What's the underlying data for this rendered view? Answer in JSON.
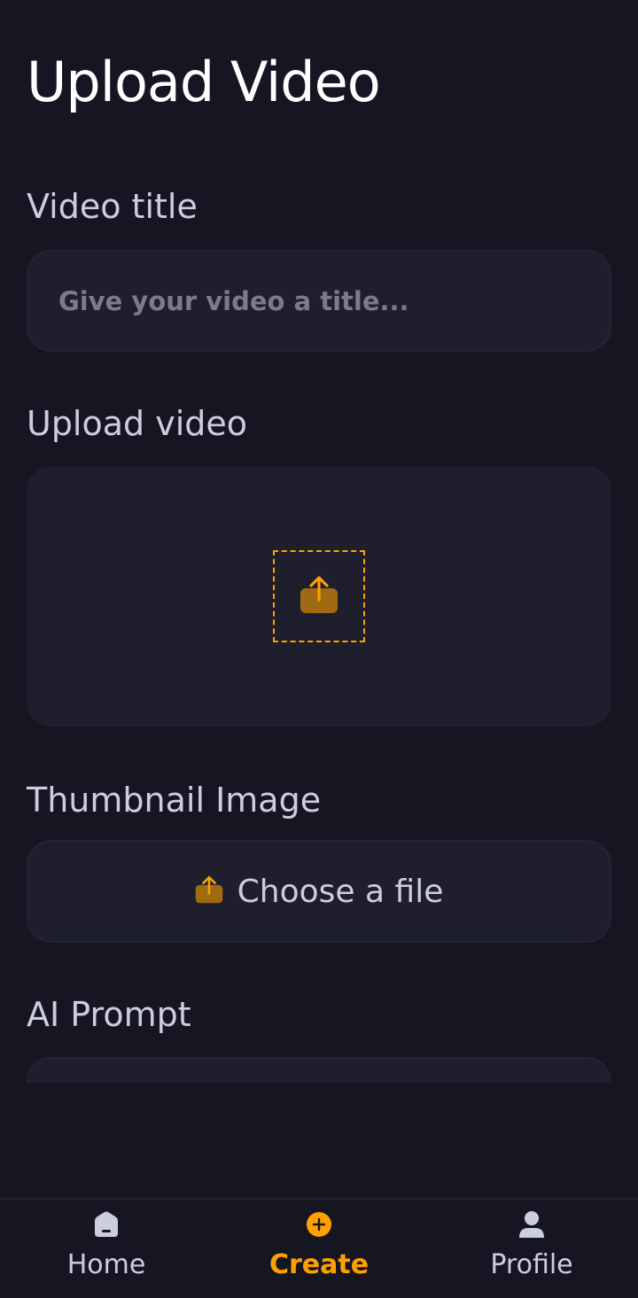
{
  "page": {
    "title": "Upload Video"
  },
  "form": {
    "video_title": {
      "label": "Video title",
      "value": "",
      "placeholder": "Give your video a title..."
    },
    "upload_video": {
      "label": "Upload video",
      "icon": "upload-icon"
    },
    "thumbnail": {
      "label": "Thumbnail Image",
      "button_label": "Choose a file",
      "icon": "upload-icon"
    },
    "ai_prompt": {
      "label": "AI Prompt",
      "value": ""
    }
  },
  "tabbar": {
    "items": [
      {
        "label": "Home",
        "icon": "home-icon",
        "active": false
      },
      {
        "label": "Create",
        "icon": "plus-circle-icon",
        "active": true
      },
      {
        "label": "Profile",
        "icon": "profile-icon",
        "active": false
      }
    ]
  },
  "colors": {
    "background": "#161622",
    "field": "#1e1e2d",
    "accent": "#ffa001",
    "text_muted": "#cdcde0",
    "placeholder": "#7b7b8b"
  }
}
